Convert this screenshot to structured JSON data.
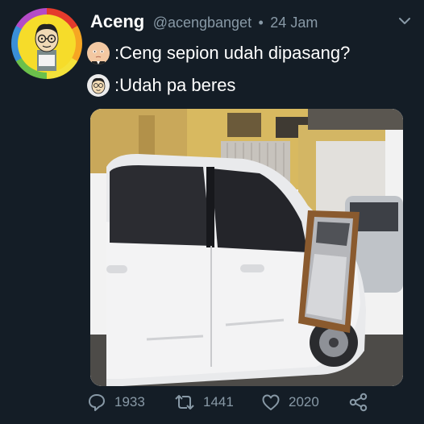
{
  "tweet": {
    "display_name": "Aceng",
    "handle": "@acengbanget",
    "separator": "•",
    "time": "24 Jam",
    "lines": [
      {
        "icon": "baby-boss-emoji-icon",
        "text": ":Ceng sepion udah dipasang?"
      },
      {
        "icon": "aceng-face-emoji-icon",
        "text": ":Udah pa beres"
      }
    ],
    "media": {
      "description_icon": "car-with-mirror-photo"
    }
  },
  "actions": {
    "reply_count": "1933",
    "retweet_count": "1441",
    "like_count": "2020"
  },
  "colors": {
    "background": "#141d26",
    "secondary_text": "#8899a6",
    "primary_text": "#ffffff"
  }
}
